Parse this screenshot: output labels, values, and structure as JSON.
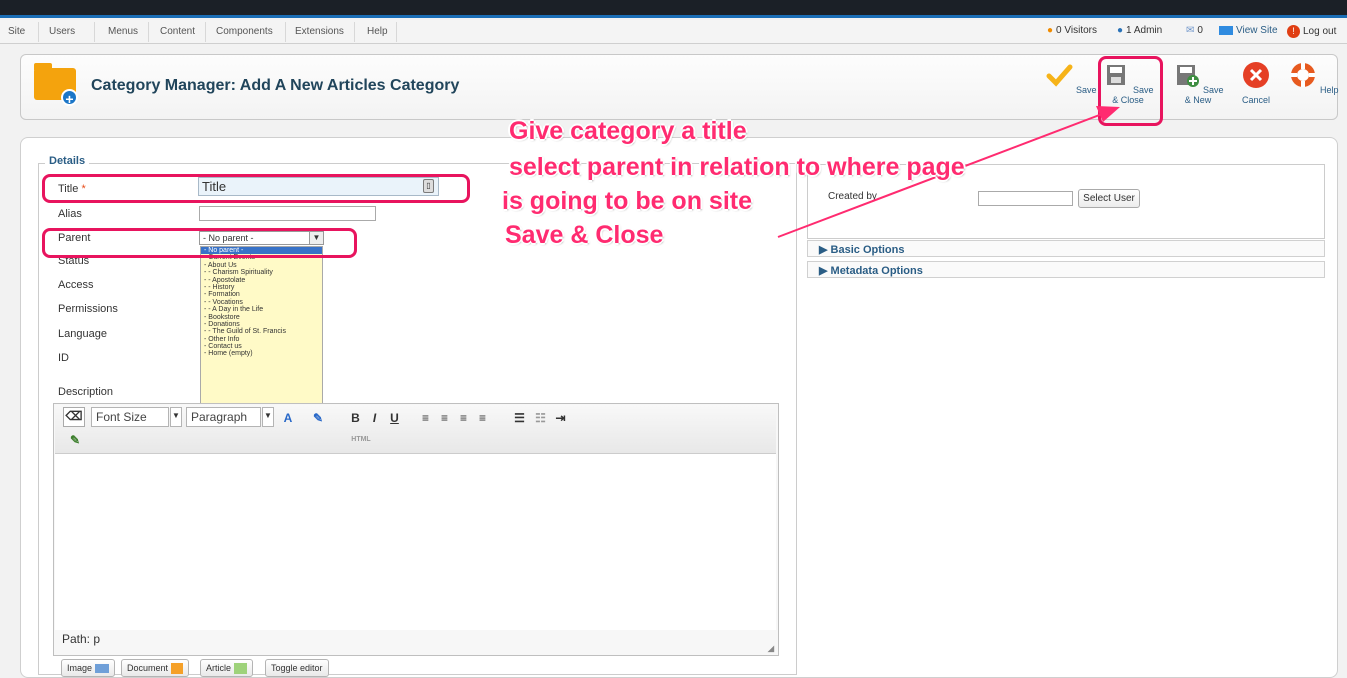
{
  "menu": [
    "Site",
    "Users",
    "Menus",
    "Content",
    "Components",
    "Extensions",
    "Help"
  ],
  "status": {
    "visitors": "0 Visitors",
    "admin": "1 Admin",
    "messages": "0",
    "view_site": "View Site",
    "logout": "Log out"
  },
  "page": {
    "title": "Category Manager: Add A New Articles Category"
  },
  "toolbar": {
    "save": "Save",
    "save_close": "Save & Close",
    "save_new": "Save & New",
    "cancel": "Cancel",
    "help": "Help"
  },
  "form": {
    "legend": "Details",
    "title_label": "Title",
    "required_mark": "*",
    "title_value": "Title",
    "alias_label": "Alias",
    "parent_label": "Parent",
    "parent_selected": "- No parent -",
    "status_label": "Status",
    "access_label": "Access",
    "permissions_label": "Permissions",
    "language_label": "Language",
    "id_label": "ID",
    "description_label": "Description"
  },
  "dropdown_options": [
    "- No parent -",
    "- Current Events",
    "- About Us",
    "- - Charism Spirituality",
    "- - Apostolate",
    "- - History",
    "- Formation",
    "- - Vocations",
    "- - A Day in the Life",
    "- Bookstore",
    "- Donations",
    "- - The Guild of St. Francis",
    "- Other Info",
    "- Contact us",
    "- Home (empty)"
  ],
  "editor": {
    "font_size": "Font Size",
    "paragraph": "Paragraph",
    "bold": "B",
    "italic": "I",
    "underline": "U",
    "html": "HTML",
    "path": "Path: p"
  },
  "editor_buttons": [
    "Image",
    "Document",
    "Article",
    "Toggle editor"
  ],
  "right": {
    "created_by_label": "Created by",
    "select_user": "Select User",
    "basic_options": "Basic Options",
    "metadata_options": "Metadata Options"
  },
  "annotation": {
    "line1": "Give category a title",
    "line2": "select parent in relation to where page",
    "line3": "is going to be on site",
    "line4": "Save & Close"
  },
  "colors": {
    "accent": "#1a6db5",
    "annotation": "#ff2b70",
    "folder": "#f4a30d",
    "save": "#f6b319",
    "cancel": "#e53f25",
    "help": "#e75a1f"
  }
}
